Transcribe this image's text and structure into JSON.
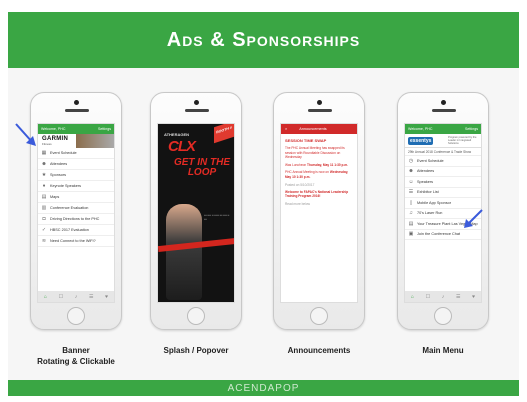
{
  "header": {
    "title": "Ads & Sponsorships"
  },
  "footer": {
    "logo_text": "ACENDAPOP"
  },
  "phones": [
    {
      "caption_line1": "Banner",
      "caption_line2": "Rotating & Clickable",
      "app_bar": {
        "left": "Welcome, PHC",
        "right": "Settings"
      },
      "banner": {
        "brand": "GARMIN",
        "sub": "Fitness"
      },
      "menu": [
        {
          "label": "Event Schedule",
          "icon": "calendar-icon"
        },
        {
          "label": "Attendees",
          "icon": "people-icon"
        },
        {
          "label": "Sponsors",
          "icon": "star-icon"
        },
        {
          "label": "Keynote Speakers",
          "icon": "mic-icon"
        },
        {
          "label": "Maps",
          "icon": "map-icon"
        },
        {
          "label": "Conference Evaluation",
          "icon": "clipboard-icon"
        },
        {
          "label": "Driving Directions to the PHC",
          "icon": "car-icon"
        },
        {
          "label": "HBSC 2017 Evaluation",
          "icon": "check-icon"
        },
        {
          "label": "Need Connect to the WiFi?",
          "icon": "wifi-icon"
        }
      ]
    },
    {
      "caption_line1": "Splash / Popover",
      "splash": {
        "brand": "ATHERAGEN",
        "mark": "CLX",
        "headline": "GET IN THE LOOP",
        "badge": "BOOTH #"
      }
    },
    {
      "caption_line1": "Announcements",
      "header_left": "×",
      "header_title": "Announcements",
      "items": [
        {
          "type": "title",
          "text": "SESSION TIME SWAP"
        },
        {
          "type": "p",
          "text": "The PHC Annual Meeting has swapped its session with Roundtable Discussion on Wednesday"
        },
        {
          "type": "p",
          "strong": "Thursday, May 11 1:30 p.m.",
          "text": "Was Luncheon"
        },
        {
          "type": "p",
          "strong": "Wednesday, May 10 1:30 p.m.",
          "text": "PHC Annual Meeting is now on"
        },
        {
          "type": "grey",
          "text": "Posted on 5/10/2017"
        },
        {
          "type": "p",
          "text": "Welcome to FAPAC's National Leadership Training Program 2016!"
        },
        {
          "type": "grey",
          "text": "Read more below"
        }
      ]
    },
    {
      "caption_line1": "Main Menu",
      "app_bar": {
        "left": "Welcome, PHC",
        "right": "Settings"
      },
      "sponsor": {
        "logo": "essentys",
        "text": "Program powered by the Leader in Integrated Solutions"
      },
      "subbar": "29th Annual 2018 Conference & Trade Show",
      "menu": [
        {
          "label": "Event Schedule",
          "icon": "clock-icon"
        },
        {
          "label": "Attendees",
          "icon": "people-icon"
        },
        {
          "label": "Speakers",
          "icon": "speaker-icon"
        },
        {
          "label": "Exhibitor List",
          "icon": "list-icon"
        },
        {
          "label": "Mobile App Sponsor",
          "icon": "phone-icon"
        },
        {
          "label": "70's Laser Run",
          "icon": "music-icon"
        },
        {
          "label": "Your Treasure Plant Las Vegas Map",
          "icon": "map-icon"
        },
        {
          "label": "Join the Conference Chat",
          "icon": "chat-icon"
        }
      ]
    }
  ],
  "colors": {
    "brand_green": "#3aa644",
    "alert_red": "#d12a2a",
    "arrow_blue": "#3b5bdb"
  }
}
